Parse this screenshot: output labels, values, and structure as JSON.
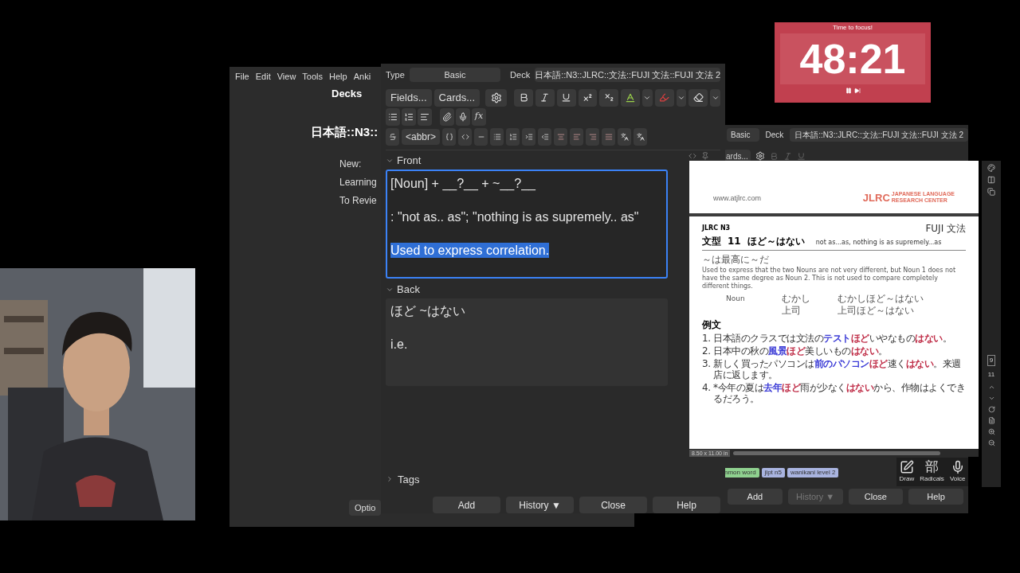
{
  "main_window": {
    "menu": [
      "File",
      "Edit",
      "View",
      "Tools",
      "Help",
      "Anki"
    ],
    "title": "Decks",
    "deck": "日本語::N3::",
    "stats": [
      "New:",
      "Learning",
      "To Revie"
    ],
    "options_button": "Optio"
  },
  "back_dialog": {
    "note_type": "Basic",
    "deck_label": "Deck",
    "deck": "日本語::N3::JLRC::文法::FUJI 文法::FUJI 文法 2",
    "cards_button": "ards...",
    "tags": [
      {
        "label": "nmon word",
        "color": "#8fd18f"
      },
      {
        "label": "jlpt n5",
        "color": "#a9b4e0"
      },
      {
        "label": "wanikani level 2",
        "color": "#a9b4e0"
      }
    ],
    "tools": [
      {
        "kind": "draw",
        "label": "Draw"
      },
      {
        "kind": "glyph",
        "glyph": "部",
        "label": "Radicals"
      },
      {
        "kind": "voice",
        "label": "Voice"
      }
    ],
    "footer": [
      {
        "label": "Add",
        "disabled": false
      },
      {
        "label": "History ▼",
        "disabled": true
      },
      {
        "label": "Close",
        "disabled": false
      },
      {
        "label": "Help",
        "disabled": false
      }
    ]
  },
  "add_dialog": {
    "type_label": "Type",
    "note_type": "Basic",
    "deck_label": "Deck",
    "deck": "日本語::N3::JLRC::文法::FUJI 文法::FUJI 文法 2",
    "fields_button": "Fields...",
    "cards_button": "Cards...",
    "fx": "fx",
    "abbr": "<abbr>",
    "fields": [
      {
        "name": "Front",
        "expanded": true,
        "focused": true,
        "lines": [
          {
            "text": "[Noun] + __?__ + ~__?__",
            "selected": false
          },
          {
            "text": ": \"not as.. as\"; \"nothing is as supremely.. as\"",
            "selected": false
          },
          {
            "text": "Used to express correlation.",
            "selected": true
          }
        ]
      },
      {
        "name": "Back",
        "expanded": true,
        "focused": false,
        "lines": [
          {
            "text": "ほど ~はない",
            "selected": false
          },
          {
            "text": "i.e.",
            "selected": false
          }
        ]
      }
    ],
    "tags_label": "Tags",
    "footer": [
      {
        "label": "Add",
        "disabled": false
      },
      {
        "label": "History ▼",
        "disabled": false
      },
      {
        "label": "Close",
        "disabled": false
      },
      {
        "label": "Help",
        "disabled": false
      }
    ]
  },
  "pdf": {
    "site": "www.atjlrc.com",
    "logo": "JLRC",
    "logo_sub": [
      "JAPANESE LANGUAGE",
      "RESEARCH CENTER"
    ],
    "level": "JLRC N3",
    "series": "FUJI 文法",
    "pattern_label": "文型",
    "pattern_number": "11",
    "pattern": "ほど～はない",
    "meaning": "not as...as, nothing is as supremely...as",
    "alt": "～は最高に～だ",
    "description": "Used to express that the two Nouns are not very different, but Noun 1 does not have the same degree as Noun 2. This is not used to compare completely different things.",
    "table": [
      {
        "label": "Noun",
        "word": "むかし",
        "example": "むかしほど～はない"
      },
      {
        "word": "上司",
        "example": "上司ほど～はない"
      }
    ],
    "examples_title": "例文",
    "examples": [
      {
        "number": "1.",
        "segments": [
          {
            "text": "日本語のクラスでは文法の"
          },
          {
            "text": "テスト",
            "color": "#3b3bd6"
          },
          {
            "text": "ほど",
            "color": "#c0304a"
          },
          {
            "text": "いやなもの"
          },
          {
            "text": "はない",
            "color": "#c0304a"
          },
          {
            "text": "。"
          }
        ]
      },
      {
        "number": "2.",
        "segments": [
          {
            "text": "日本中の秋の"
          },
          {
            "text": "風景",
            "color": "#3b3bd6"
          },
          {
            "text": "ほど",
            "color": "#c0304a"
          },
          {
            "text": "美しいもの"
          },
          {
            "text": "はない",
            "color": "#c0304a"
          },
          {
            "text": "。"
          }
        ]
      },
      {
        "number": "3.",
        "segments": [
          {
            "text": "新しく買ったパソコンは"
          },
          {
            "text": "前のパソコン",
            "color": "#3b3bd6"
          },
          {
            "text": "ほど",
            "color": "#c0304a"
          },
          {
            "text": "速く"
          },
          {
            "text": "はない",
            "color": "#c0304a"
          },
          {
            "text": "。来週店に返します。"
          }
        ]
      },
      {
        "number": "4.",
        "segments": [
          {
            "text": "*今年の夏は"
          },
          {
            "text": "去年",
            "color": "#3b3bd6"
          },
          {
            "text": "ほど",
            "color": "#c0304a"
          },
          {
            "text": "雨が少なく"
          },
          {
            "text": "はない",
            "color": "#c0304a"
          },
          {
            "text": "から、作物はよくできるだろう。"
          }
        ]
      }
    ],
    "page_size": "8.50 x 11.00 in",
    "page_number": "9",
    "page_total": "11"
  },
  "timer": {
    "caption": "Time to focus!",
    "time": "48:21"
  }
}
